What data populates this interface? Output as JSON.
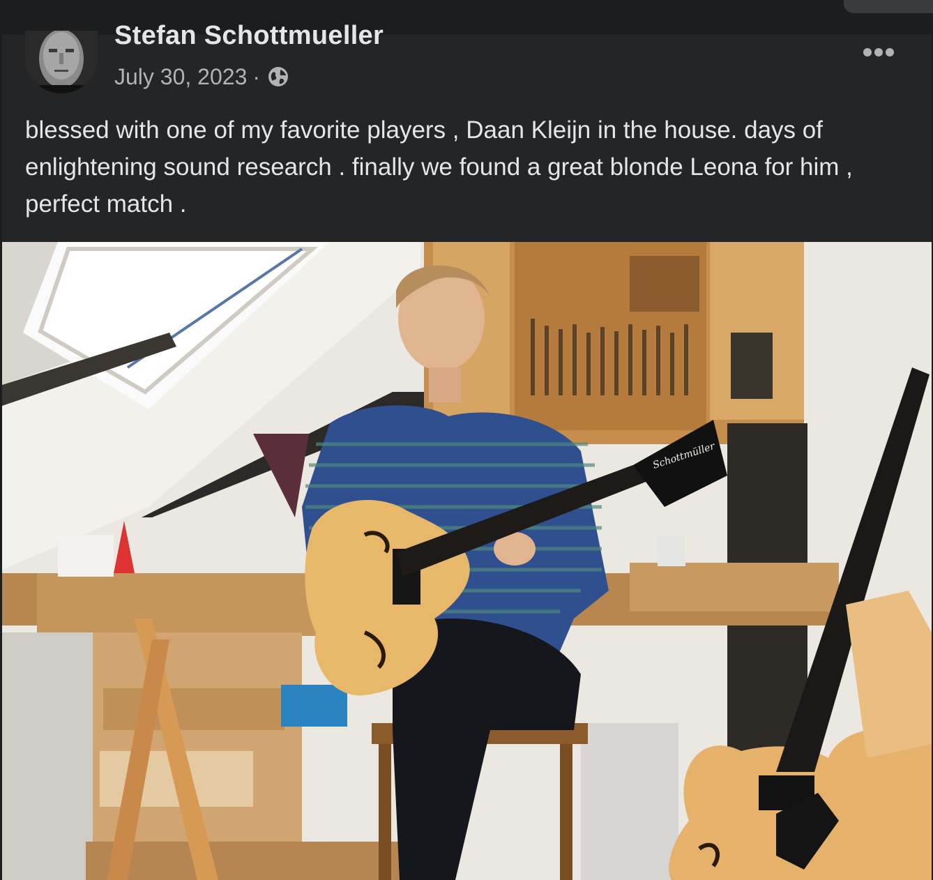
{
  "post": {
    "author": "Stefan Schottmueller",
    "date": "July 30, 2023",
    "separator": "·",
    "privacy_icon": "globe-icon",
    "more_icon": "more-options-icon",
    "text": "blessed with one of my favorite players , Daan Kleijn in the house. days of enlightening sound research . finally we found a great blonde Leona for him , perfect match .",
    "photo_brand_text": "Schottmüller"
  },
  "colors": {
    "background": "#242526",
    "text_primary": "#e4e6eb",
    "text_secondary": "#b0b3b8",
    "guitar_wood": "#e8b86a",
    "shirt_blue": "#2f4f8f"
  }
}
